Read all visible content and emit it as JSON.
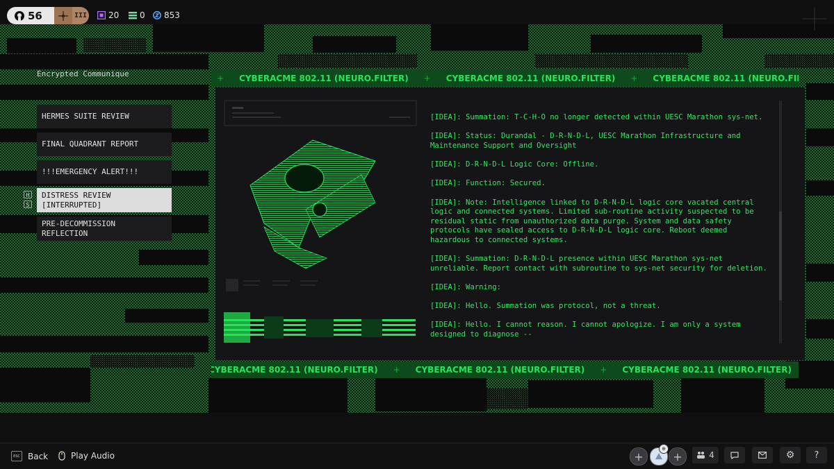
{
  "hud": {
    "level": "56",
    "rank_mark": "III",
    "stats": [
      {
        "icon": "purple-chip-icon",
        "value": "20",
        "color": "#b36bff"
      },
      {
        "icon": "green-stack-icon",
        "value": "0",
        "color": "#5ee6a0"
      },
      {
        "icon": "blue-coin-icon",
        "value": "853",
        "color": "#5aa8ff"
      }
    ]
  },
  "sidebar": {
    "title": "Encrypted Communique",
    "items": [
      {
        "label": "HERMES SUITE REVIEW"
      },
      {
        "label": "FINAL QUADRANT REPORT"
      },
      {
        "label": "!!!EMERGENCY ALERT!!!"
      },
      {
        "label": "DISTRESS REVIEW\n[INTERRUPTED]",
        "selected": true
      },
      {
        "label": "PRE-DECOMMISSION\nREFLECTION"
      }
    ],
    "hint_keys": [
      "H",
      "S"
    ]
  },
  "banner_text": "CYBERACME 802.11 (NEURO.FILTER)",
  "log_lines": [
    "[IDEA]: Summation: T-C-H-O no longer detected within UESC Marathon sys-net.",
    "[IDEA]: Status: Durandal - D-R-N-D-L, UESC Marathon Infrastructure and Maintenance Support and Oversight",
    "[IDEA]: D-R-N-D-L Logic Core: Offline.",
    "[IDEA]: Function: Secured.",
    "[IDEA]: Note: Intelligence linked to D-R-N-D-L logic core vacated central logic and connected systems. Limited sub-routine activity suspected to be residual static from unauthorized data purge. System and data safety protocols have sealed access to D-R-N-D-L logic core. Reboot deemed hazardous to connected systems.",
    "[IDEA]: Summation: D-R-N-D-L presence within UESC Marathon sys-net unreliable. Report contact with subroutine to sys-net security for deletion.",
    "[IDEA]: Warning:",
    "[IDEA]: Hello. Summation was protocol, not a threat.",
    "[IDEA]: Hello. I cannot reason. I cannot apologize. I am only a system designed to diagnose --"
  ],
  "bottom": {
    "back_label": "Back",
    "back_key": "ESC",
    "audio_label": "Play Audio",
    "squad_count": "4"
  },
  "colors": {
    "accent_green": "#27e35b",
    "banner_bg": "#0d4a1c",
    "panel_bg": "#151517"
  }
}
